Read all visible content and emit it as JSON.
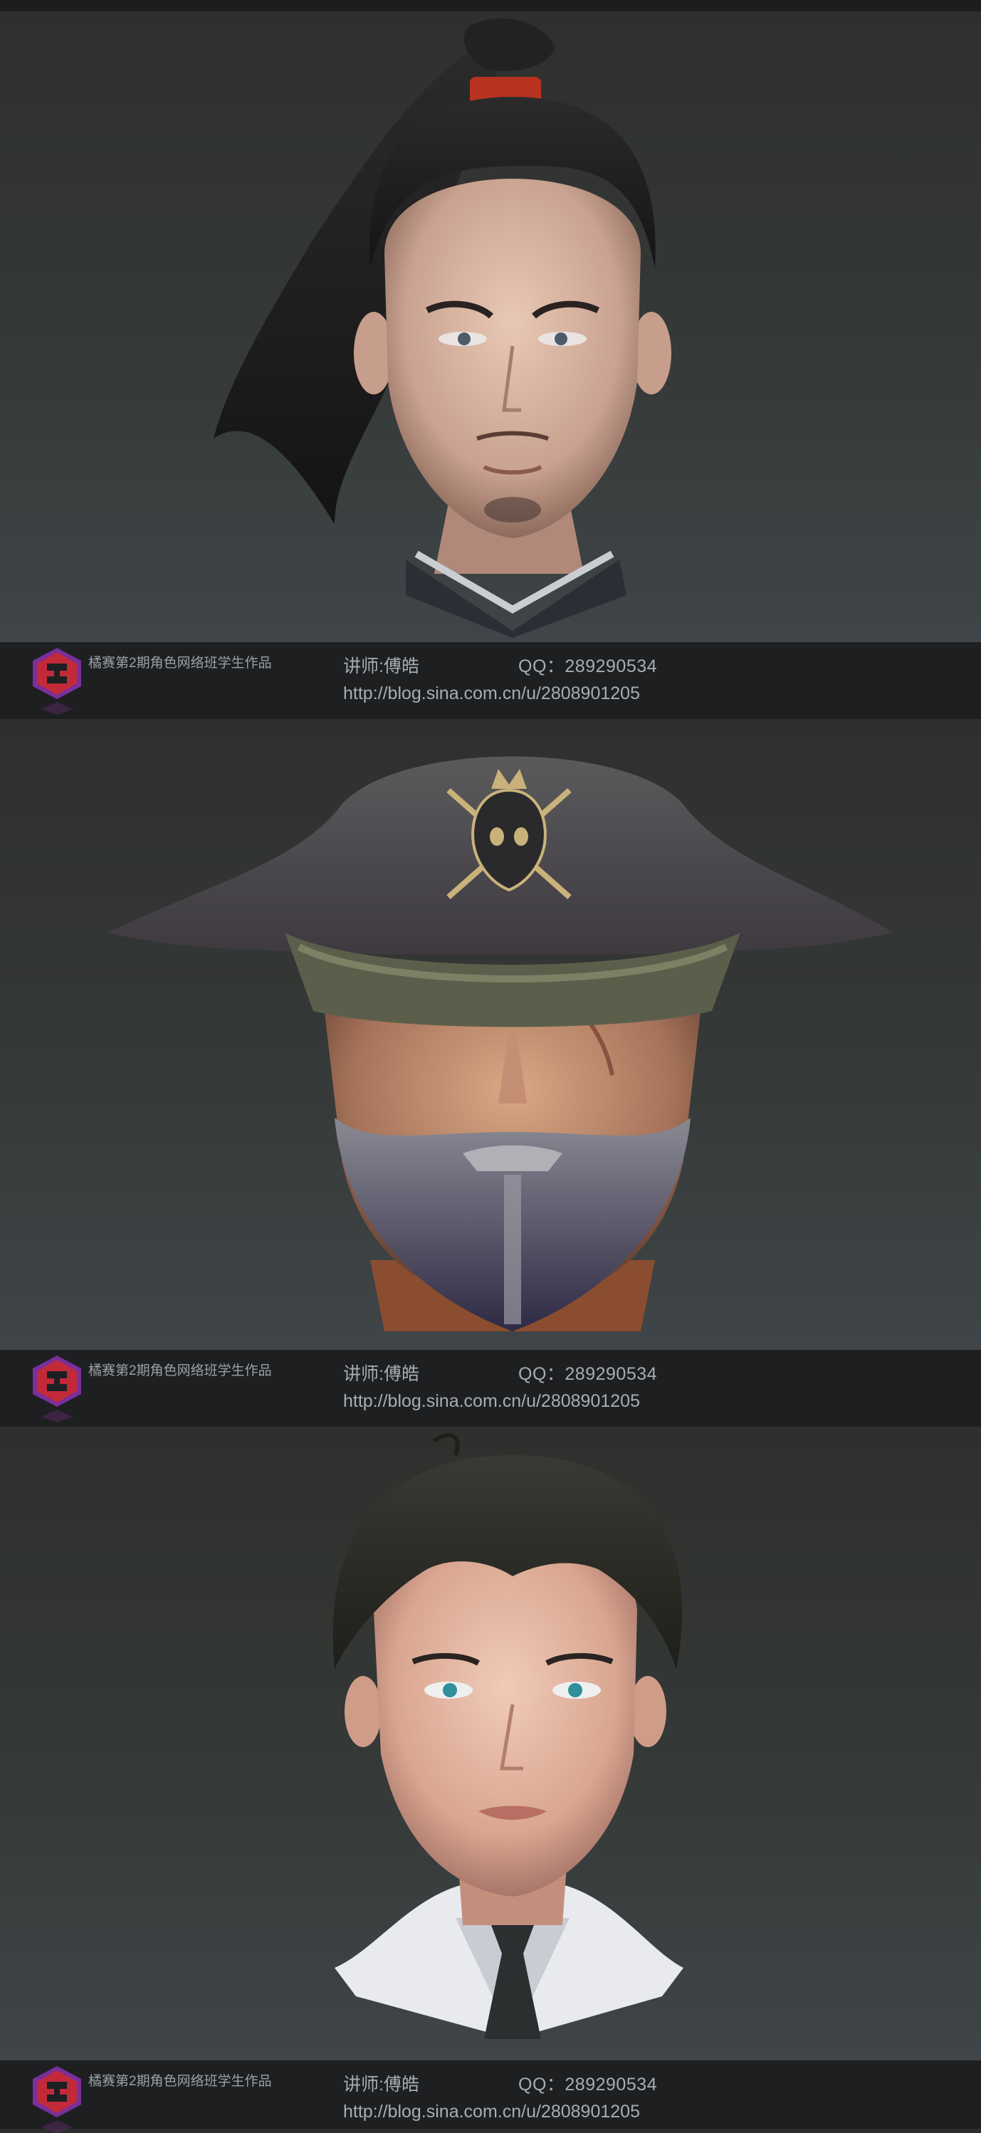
{
  "colors": {
    "caption_bar": "#1e1f21",
    "caption_text": "#a8adb0",
    "panel_top": "#2e302d",
    "panel_bottom": "#3f4548",
    "logo_red": "#c22a3a",
    "logo_purple": "#7a2f9a"
  },
  "panels": [
    {
      "subject": "young-man-ponytail-head-render",
      "caption": {
        "school": "橘赛第2期角色网络班学生作品",
        "teacher": "讲师:傅皓",
        "qq": "QQ：289290534",
        "blog": "http://blog.sina.com.cn/u/2808901205"
      }
    },
    {
      "subject": "old-pirate-tricorn-hat-head-render",
      "caption": {
        "school": "橘赛第2期角色网络班学生作品",
        "teacher": "讲师:傅皓",
        "qq": "QQ：289290534",
        "blog": "http://blog.sina.com.cn/u/2808901205"
      }
    },
    {
      "subject": "young-man-shirt-tie-head-render",
      "caption": {
        "school": "橘赛第2期角色网络班学生作品",
        "teacher": "讲师:傅皓",
        "qq": "QQ：289290534",
        "blog": "http://blog.sina.com.cn/u/2808901205"
      }
    }
  ]
}
